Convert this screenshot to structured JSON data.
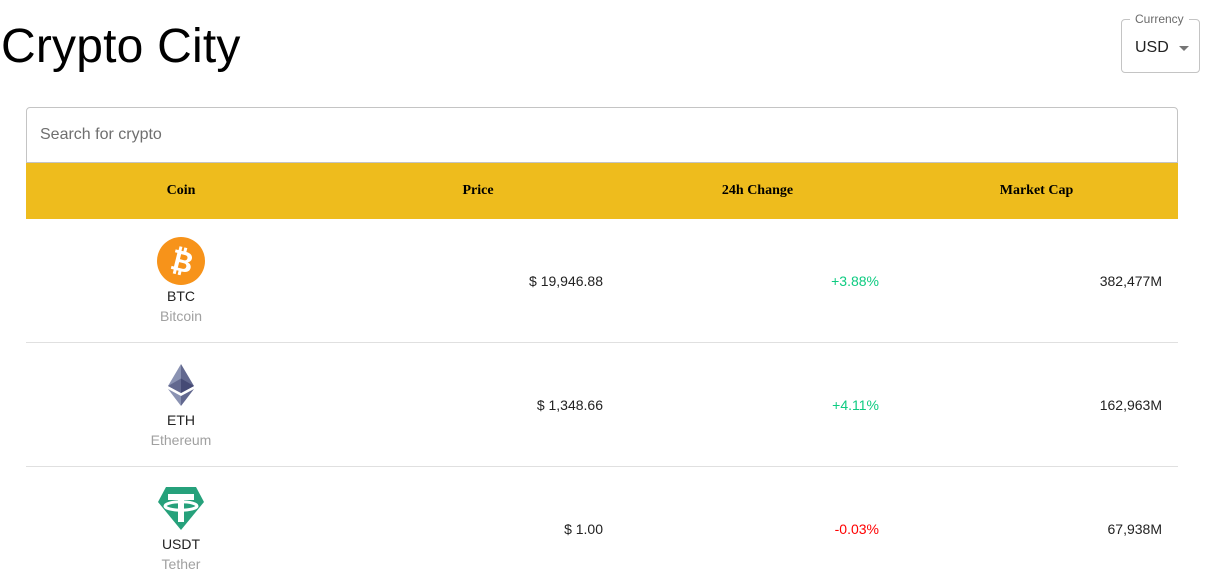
{
  "app": {
    "title": "Crypto City"
  },
  "currency": {
    "label": "Currency",
    "value": "USD"
  },
  "search": {
    "placeholder": "Search for crypto",
    "value": ""
  },
  "table": {
    "headers": {
      "coin": "Coin",
      "price": "Price",
      "change": "24h Change",
      "market_cap": "Market Cap"
    },
    "header_color": "#eebc1d",
    "rows": [
      {
        "symbol": "BTC",
        "name": "Bitcoin",
        "icon": "bitcoin-icon",
        "price": "$ 19,946.88",
        "change": "+3.88%",
        "change_direction": "up",
        "market_cap": "382,477M"
      },
      {
        "symbol": "ETH",
        "name": "Ethereum",
        "icon": "ethereum-icon",
        "price": "$ 1,348.66",
        "change": "+4.11%",
        "change_direction": "up",
        "market_cap": "162,963M"
      },
      {
        "symbol": "USDT",
        "name": "Tether",
        "icon": "tether-icon",
        "price": "$ 1.00",
        "change": "-0.03%",
        "change_direction": "down",
        "market_cap": "67,938M"
      }
    ]
  },
  "colors": {
    "positive": "#0ecb81",
    "negative": "#ff0000",
    "bitcoin": "#f7931a",
    "ethereum": "#627eea",
    "tether": "#26a17b"
  }
}
